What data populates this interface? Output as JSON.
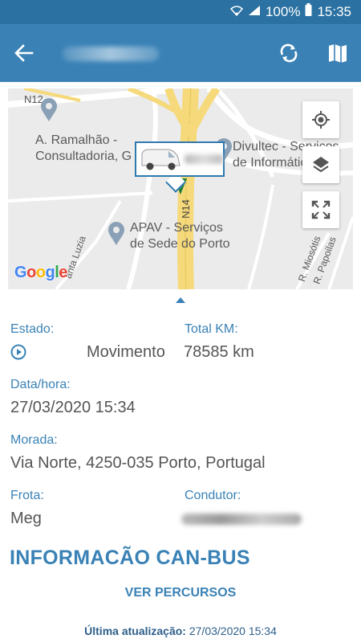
{
  "status_bar": {
    "battery": "100%",
    "time": "15:35",
    "icons": [
      "wifi-icon",
      "signal-icon",
      "battery-icon"
    ]
  },
  "appbar": {
    "icons": [
      "back-arrow-icon",
      "refresh-icon",
      "map-icon"
    ]
  },
  "map": {
    "roads": {
      "n12": "N12",
      "n14": "N14"
    },
    "places": {
      "ramalhao_line1": "A. Ramalhão -",
      "ramalhao_line2": "Consultadoria, G",
      "divultec_line1": "Divultec - Serviços",
      "divultec_line2": "de Informática Lda",
      "apav_line1": "APAV - Serviços",
      "apav_line2": "de Sede do Porto",
      "santa_luzia": "anta Luzia",
      "miosotis": "R. Miosótis",
      "papoilas": "R. Papoilas"
    },
    "google": "Google",
    "controls": [
      "my-location-icon",
      "layers-icon",
      "fullscreen-icon"
    ]
  },
  "details": {
    "estado_label": "Estado:",
    "estado_value": "Movimento",
    "total_km_label": "Total KM:",
    "total_km_value": "78585 km",
    "datahora_label": "Data/hora:",
    "datahora_value": "27/03/2020 15:34",
    "morada_label": "Morada:",
    "morada_value": "Via Norte, 4250-035 Porto, Portugal",
    "frota_label": "Frota:",
    "frota_value": "Meg",
    "condutor_label": "Condutor:"
  },
  "canbus_title": "INFORMACÃO CAN-BUS",
  "routes_button": "VER PERCURSOS",
  "last_update_label": "Última atualização:",
  "last_update_value": "27/03/2020 15:34",
  "colors": {
    "appbar": "#3a82b6",
    "statusbar": "#2b71a2",
    "accent": "#3a82b6",
    "road_yellow": "#f5d97a"
  }
}
